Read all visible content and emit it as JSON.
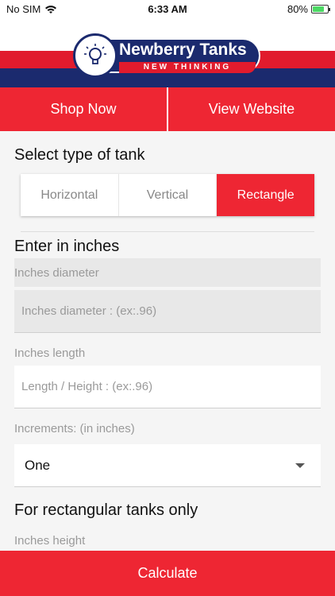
{
  "status_bar": {
    "carrier": "No SIM",
    "time": "6:33 AM",
    "battery_percent": "80%",
    "battery_level": 0.8
  },
  "brand": {
    "name": "Newberry Tanks",
    "tagline": "NEW THINKING",
    "colors": {
      "red": "#ee2633",
      "navy": "#1b2a6e"
    }
  },
  "top_buttons": {
    "shop": "Shop Now",
    "website": "View Website"
  },
  "tank_type": {
    "title": "Select type of tank",
    "options": [
      "Horizontal",
      "Vertical",
      "Rectangle"
    ],
    "selected": "Rectangle"
  },
  "inches": {
    "title": "Enter in inches",
    "diameter_label": "Inches diameter",
    "diameter_placeholder": "Inches diameter : (ex:.96)",
    "length_label": "Inches length",
    "length_placeholder": "Length / Height : (ex:.96)",
    "increments_label": "Increments: (in inches)",
    "increments_value": "One"
  },
  "rectangular": {
    "title": "For rectangular tanks only",
    "height_label": "Inches height"
  },
  "calculate_label": "Calculate"
}
